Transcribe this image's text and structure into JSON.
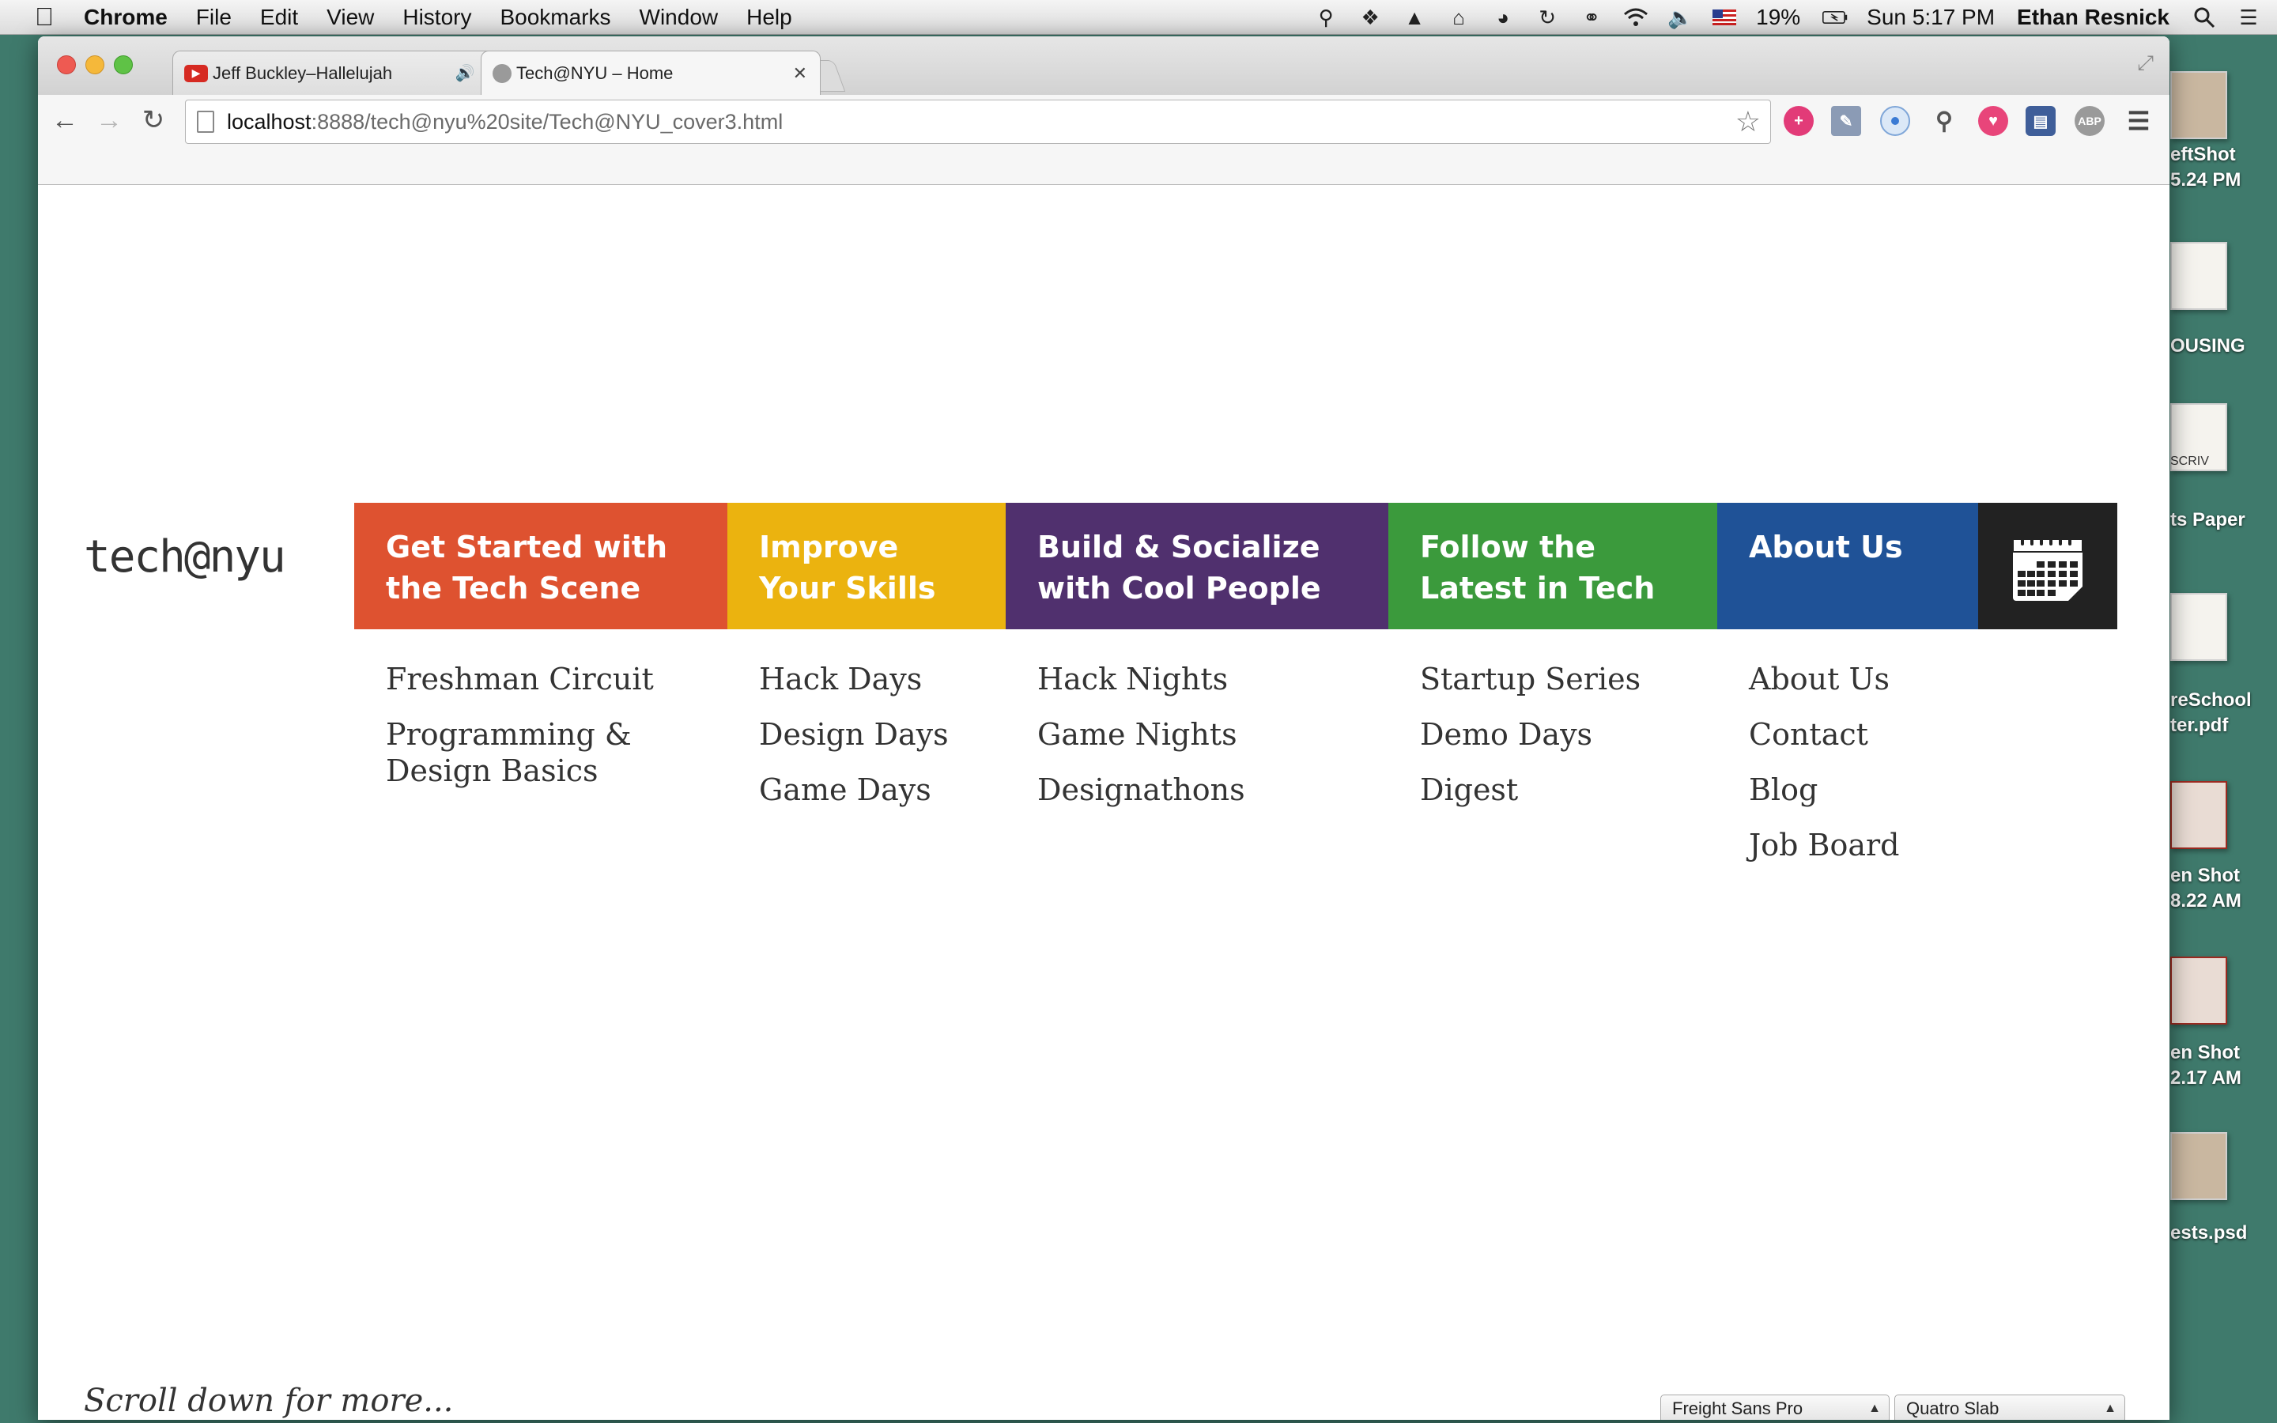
{
  "menubar": {
    "app_name": "Chrome",
    "items": [
      "File",
      "Edit",
      "View",
      "History",
      "Bookmarks",
      "Window",
      "Help"
    ],
    "battery": "19%",
    "clock": "Sun 5:17 PM",
    "user": "Ethan Resnick",
    "tray_icons": [
      "key-icon",
      "dropbox-icon",
      "drive-icon",
      "home-icon",
      "headphones-icon",
      "sync-icon",
      "creative-cloud-icon",
      "wifi-icon",
      "volume-icon",
      "flag-icon",
      "battery-icon"
    ]
  },
  "browser": {
    "tabs": [
      {
        "title": "Jeff Buckley–Hallelujah",
        "active": false,
        "audio": true
      },
      {
        "title": "Tech@NYU – Home",
        "active": true,
        "audio": false
      }
    ],
    "url_host": "localhost",
    "url_rest": ":8888/tech@nyu%20site/Tech@NYU_cover3.html"
  },
  "site": {
    "logo_text": "tech@nyu",
    "nav": [
      {
        "header_line1": "Get Started with",
        "header_line2": "the Tech Scene",
        "color": "#de5230",
        "links": [
          "Freshman Circuit",
          "Programming & Design Basics"
        ]
      },
      {
        "header_line1": "Improve",
        "header_line2": "Your Skills",
        "color": "#ebb30f",
        "links": [
          "Hack Days",
          "Design Days",
          "Game Days"
        ]
      },
      {
        "header_line1": "Build & Socialize",
        "header_line2": "with Cool People",
        "color": "#50306e",
        "links": [
          "Hack Nights",
          "Game Nights",
          "Designathons"
        ]
      },
      {
        "header_line1": "Follow the",
        "header_line2": "Latest in Tech",
        "color": "#3b9a3c",
        "links": [
          "Startup Series",
          "Demo Days",
          "Digest"
        ]
      },
      {
        "header_line1": "About Us",
        "header_line2": "",
        "color": "#1f5297",
        "links": [
          "About Us",
          "Contact",
          "Blog",
          "Job Board"
        ]
      }
    ],
    "calendar_color": "#222222",
    "scroll_hint": "Scroll down for more...",
    "font_select_1": "Freight Sans Pro",
    "font_select_2": "Quatro Slab"
  },
  "desktop": {
    "labels": [
      "eftShot",
      "5.24 PM",
      "OUSING",
      "SCRIV",
      "ts Paper",
      "reSchool",
      "ter.pdf",
      "en Shot",
      "8.22 AM",
      "en Shot",
      "2.17 AM",
      "ests.psd"
    ]
  }
}
